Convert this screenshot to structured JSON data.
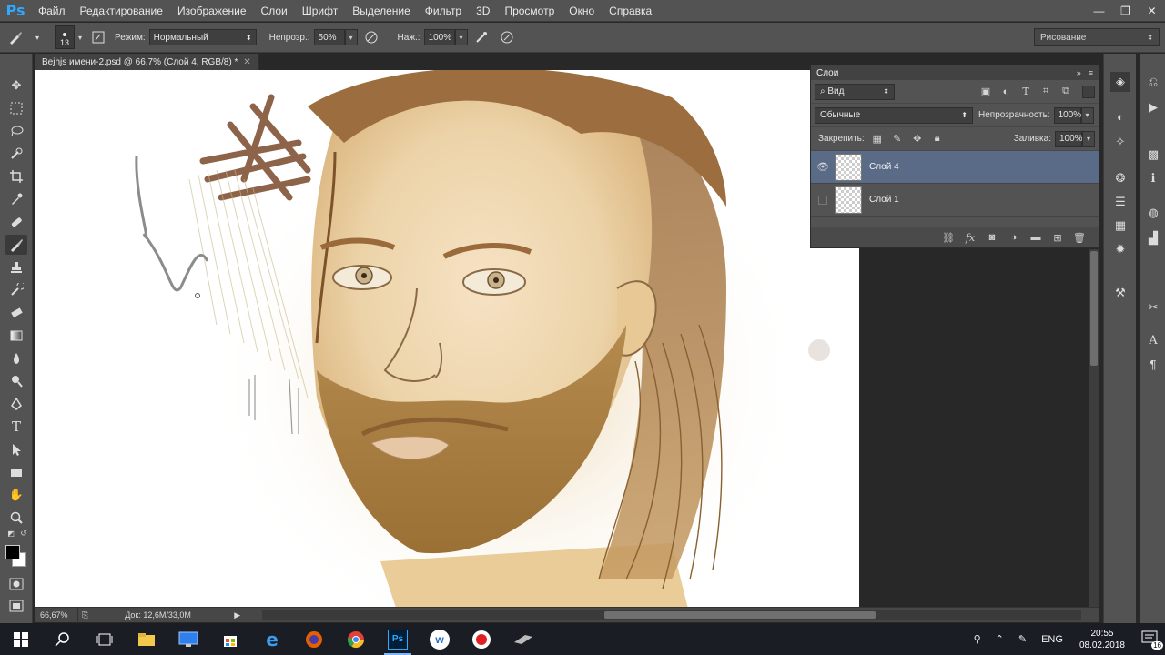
{
  "app": {
    "logo": "Ps"
  },
  "menu": [
    "Файл",
    "Редактирование",
    "Изображение",
    "Слои",
    "Шрифт",
    "Выделение",
    "Фильтр",
    "3D",
    "Просмотр",
    "Окно",
    "Справка"
  ],
  "window_controls": {
    "minimize": "—",
    "restore": "❐",
    "close": "✕"
  },
  "options": {
    "brush_size": "13",
    "mode_label": "Режим:",
    "mode_value": "Нормальный",
    "opacity_label": "Непрозр.:",
    "opacity_value": "50%",
    "pressure_label": "Наж.:",
    "pressure_value": "100%",
    "workspace": "Рисование"
  },
  "document": {
    "tab_title": "Bejhjs имени-2.psd @ 66,7% (Слой 4, RGB/8) *",
    "zoom": "66,67%",
    "doc_size": "Док: 12,6M/33,0M"
  },
  "layers_panel": {
    "title": "Слои",
    "filter_label": "Вид",
    "blend_mode": "Обычные",
    "opacity_label": "Непрозрачность:",
    "opacity_value": "100%",
    "lock_label": "Закрепить:",
    "fill_label": "Заливка:",
    "fill_value": "100%",
    "layers": [
      {
        "name": "Слой 4",
        "visible": true,
        "selected": true
      },
      {
        "name": "Слой 1",
        "visible": false,
        "selected": false
      }
    ]
  },
  "taskbar": {
    "language": "ENG",
    "time": "20:55",
    "date": "08.02.2018",
    "notifications": "16"
  },
  "colors": {
    "foreground": "#000000",
    "background": "#ffffff",
    "selected_layer": "#5a6b87",
    "ps_blue": "#31a8ff"
  }
}
